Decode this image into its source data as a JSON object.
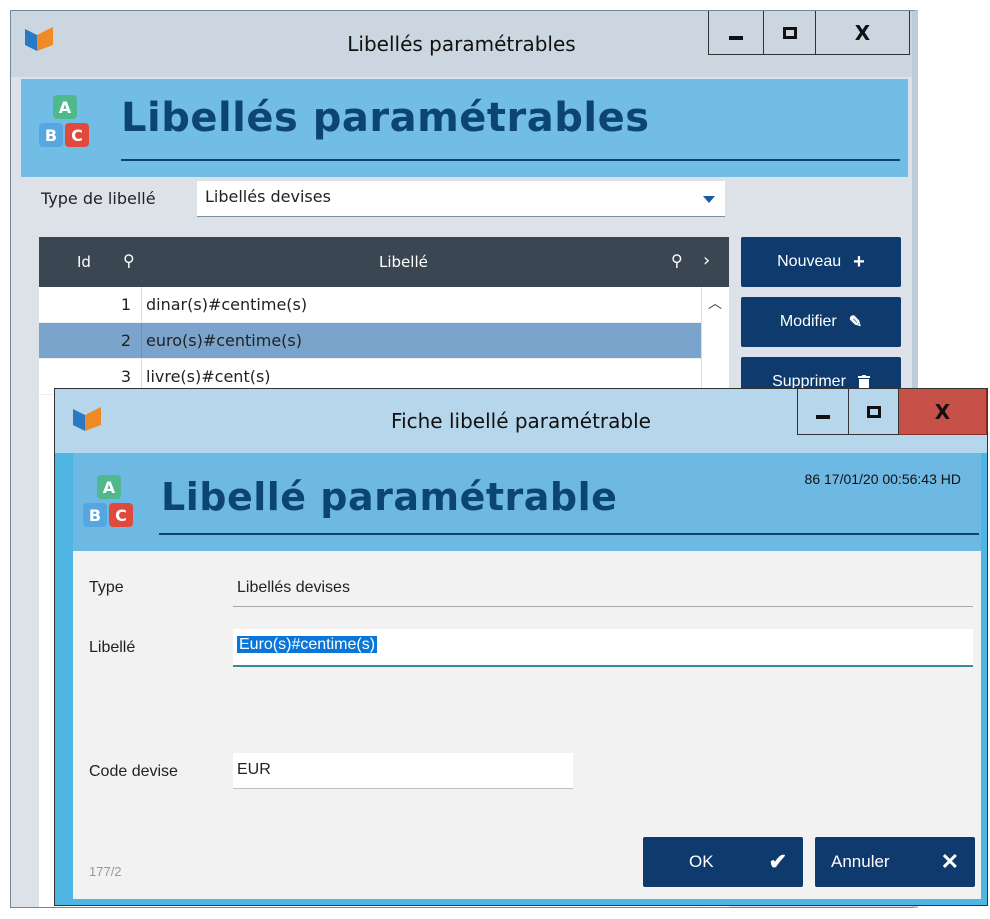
{
  "main_window": {
    "title": "Libellés paramétrables",
    "banner_title": "Libellés paramétrables",
    "type_label": "Type de libellé",
    "type_value": "Libellés devises",
    "grid": {
      "col_id": "Id",
      "col_libelle": "Libellé",
      "rows": [
        {
          "id": "1",
          "libelle": "dinar(s)#centime(s)"
        },
        {
          "id": "2",
          "libelle": "euro(s)#centime(s)"
        },
        {
          "id": "3",
          "libelle": "livre(s)#cent(s)"
        }
      ]
    },
    "buttons": {
      "nouveau": "Nouveau",
      "modifier": "Modifier",
      "supprimer": "Supprimer"
    }
  },
  "dialog": {
    "title": "Fiche libellé paramétrable",
    "header_title": "Libellé paramétrable",
    "meta": "86  17/01/20 00:56:43  HD",
    "fields": {
      "type_label": "Type",
      "type_value": "Libellés devises",
      "libelle_label": "Libellé",
      "libelle_value": "Euro(s)#centime(s)",
      "code_label": "Code devise",
      "code_value": "EUR"
    },
    "footer_code": "177/2",
    "ok_label": "OK",
    "cancel_label": "Annuler"
  },
  "window_controls": {
    "close_glyph": "X"
  },
  "colors": {
    "accent_dark": "#0e3a6d",
    "banner_blue": "#72bde6",
    "selection": "#7aa4cb",
    "close_red": "#c75149"
  }
}
